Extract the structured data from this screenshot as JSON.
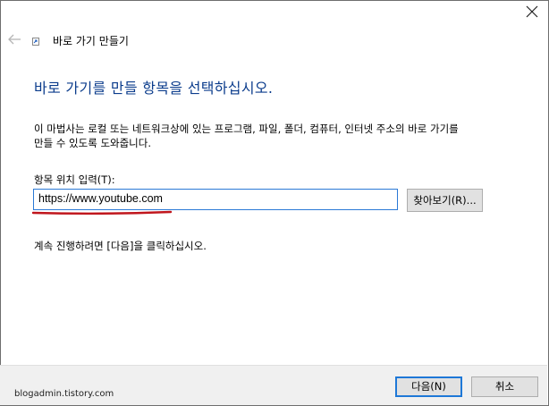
{
  "window": {
    "title": "바로 가기 만들기"
  },
  "main": {
    "heading": "바로 가기를 만들 항목을 선택하십시오.",
    "description_line1": "이 마법사는 로컬 또는 네트워크상에 있는 프로그램, 파일, 폴더, 컴퓨터, 인터넷 주소의 바로 가기를",
    "description_line2": "만들 수 있도록 도와줍니다.",
    "location_label": "항목 위치 입력(T):",
    "location_value": "https://www.youtube.com",
    "browse_label": "찾아보기(R)...",
    "hint": "계속 진행하려면 [다음]을 클릭하십시오."
  },
  "footer": {
    "next_label": "다음(N)",
    "cancel_label": "취소",
    "watermark": "blogadmin.tistory.com"
  },
  "colors": {
    "heading": "#0b3c8c",
    "input_border": "#2b79d6",
    "underline": "#c0161d"
  },
  "icons": {
    "close": "close-icon",
    "back": "back-arrow-icon",
    "app": "shortcut-icon"
  }
}
